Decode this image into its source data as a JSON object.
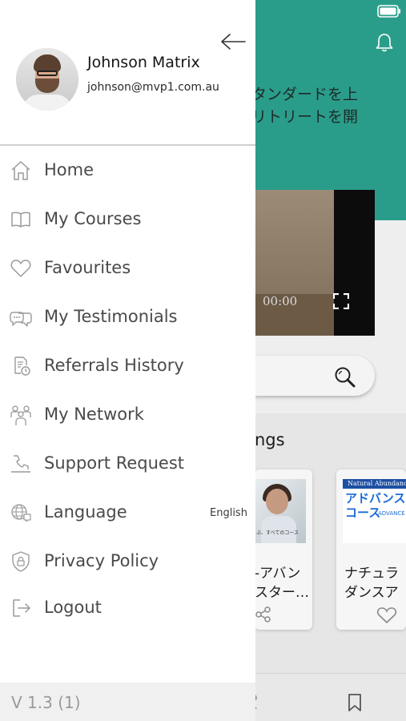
{
  "colors": {
    "accent": "#2a9d8a",
    "drawer_background": "#ffffff",
    "menu_text": "#4a4a4a",
    "icon": "#9a9a9a"
  },
  "background_app": {
    "hero_text_line1": "タンダードを上",
    "hero_text_line2": "リトリートを開",
    "video_time": "00:00",
    "section_title": "ngs",
    "card1_line1": "-アバン",
    "card1_line2": "スター…",
    "card1_caption": "ぶ、すべてのコース",
    "card2_line1": "ナチュラ",
    "card2_line2": "ダンスア",
    "card2_badge": "Natural Abundance",
    "card2_image_title1": "アドバンス",
    "card2_image_title2": "コース",
    "card2_image_sub": "ADVANCE"
  },
  "drawer": {
    "user": {
      "name": "Johnson Matrix",
      "email": "johnson@mvp1.com.au"
    },
    "menu": [
      {
        "label": "Home",
        "icon": "home-icon"
      },
      {
        "label": "My Courses",
        "icon": "book-icon"
      },
      {
        "label": "Favourites",
        "icon": "heart-icon"
      },
      {
        "label": "My Testimonials",
        "icon": "chat-bubbles-icon"
      },
      {
        "label": "Referrals History",
        "icon": "document-clock-icon"
      },
      {
        "label": "My Network",
        "icon": "people-icon"
      },
      {
        "label": "Support Request",
        "icon": "support-icon"
      },
      {
        "label": "Language",
        "icon": "globe-chat-icon",
        "value": "English"
      },
      {
        "label": "Privacy Policy",
        "icon": "shield-lock-icon"
      },
      {
        "label": "Logout",
        "icon": "logout-icon"
      }
    ],
    "version": "V 1.3 (1)"
  }
}
